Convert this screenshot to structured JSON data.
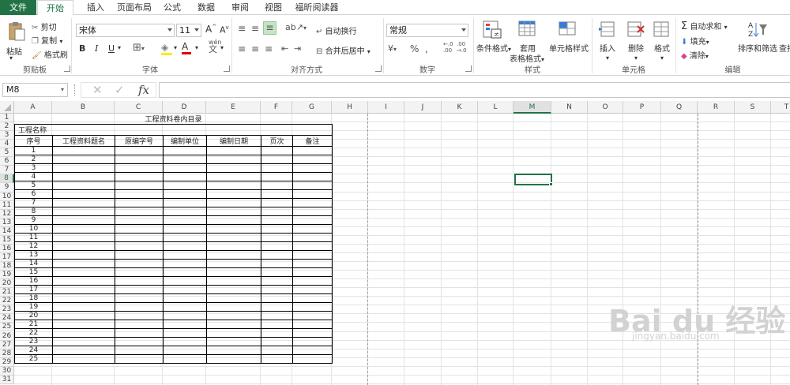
{
  "tabs": [
    "文件",
    "开始",
    "插入",
    "页面布局",
    "公式",
    "数据",
    "审阅",
    "视图",
    "福昕阅读器"
  ],
  "active_tab_index": 1,
  "clipboard": {
    "paste": "粘贴",
    "cut": "剪切",
    "copy": "复制",
    "format_painter": "格式刷",
    "group": "剪贴板"
  },
  "font": {
    "name": "宋体",
    "size": "11",
    "group": "字体",
    "bold": "B",
    "italic": "I",
    "underline": "U"
  },
  "align": {
    "wrap": "自动换行",
    "merge": "合并后居中",
    "group": "对齐方式"
  },
  "number": {
    "format": "常规",
    "group": "数字"
  },
  "styles": {
    "conditional": "条件格式",
    "table_1": "套用",
    "table_2": "表格格式",
    "cell_styles": "单元格样式",
    "group": "样式"
  },
  "cells": {
    "insert": "插入",
    "delete": "删除",
    "format": "格式",
    "group": "单元格"
  },
  "editing": {
    "autosum": "自动求和",
    "fill": "填充",
    "clear": "清除",
    "sort": "排序和筛选",
    "find": "查找",
    "group": "编辑"
  },
  "formula_bar": {
    "name_box": "M8",
    "value": ""
  },
  "columns": [
    "A",
    "B",
    "C",
    "D",
    "E",
    "F",
    "G",
    "H",
    "I",
    "J",
    "K",
    "L",
    "M",
    "N",
    "O",
    "P",
    "Q",
    "R",
    "S",
    "T"
  ],
  "selected_column": "M",
  "selected_row": 8,
  "sheet": {
    "title": "工程资料卷内目录",
    "project_label": "工程名称",
    "headers": [
      "序号",
      "工程资料题名",
      "原编字号",
      "编制单位",
      "编制日期",
      "页次",
      "备注"
    ],
    "numbers": [
      "1",
      "2",
      "3",
      "4",
      "5",
      "6",
      "7",
      "8",
      "9",
      "10",
      "11",
      "12",
      "13",
      "14",
      "15",
      "16",
      "17",
      "18",
      "19",
      "20",
      "21",
      "22",
      "23",
      "24",
      "25"
    ]
  },
  "watermark": {
    "logo": "Bai du 经验",
    "url": "jingyan.baidu.com"
  }
}
